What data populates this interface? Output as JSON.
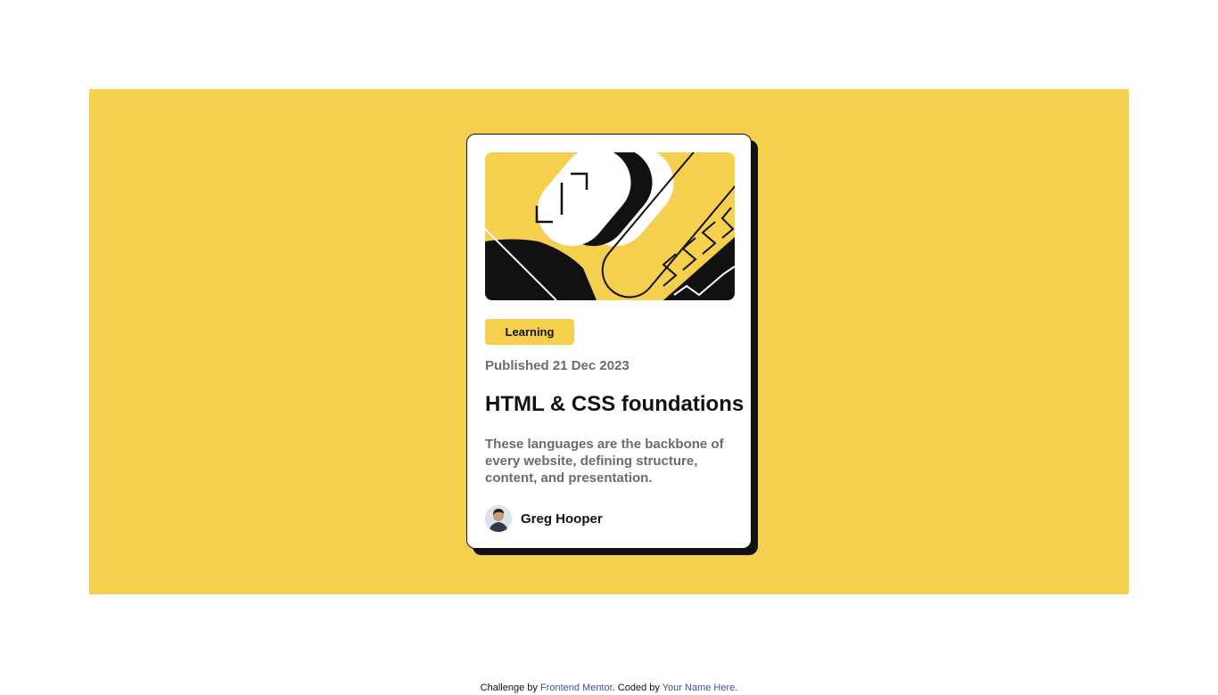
{
  "card": {
    "tag": "Learning",
    "published": "Published 21 Dec 2023",
    "title": "HTML & CSS foundations",
    "description": "These languages are the backbone of every website, defining structure, content, and presentation.",
    "author": "Greg Hooper"
  },
  "attribution": {
    "prefix": "Challenge by ",
    "link1": "Frontend Mentor",
    "middle": ". Coded by ",
    "link2": "Your Name Here",
    "suffix": "."
  },
  "colors": {
    "background": "#F4D04E",
    "card": "#FFFFFF",
    "ink": "#111111",
    "muted": "#6B6B6B",
    "link": "#3E52A3"
  },
  "icons": {
    "hero": "illustration-article",
    "avatar": "image-avatar"
  }
}
